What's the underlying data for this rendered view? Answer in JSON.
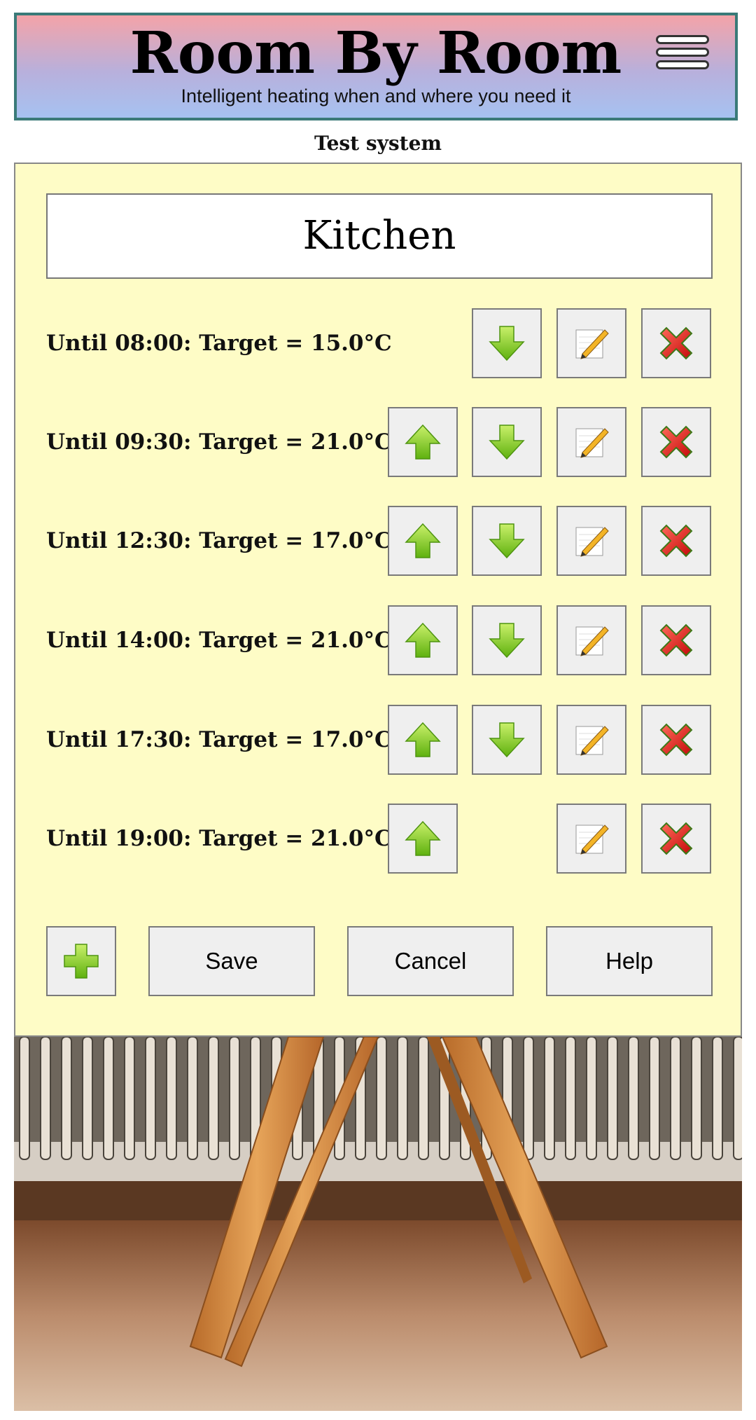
{
  "header": {
    "title": "Room By Room",
    "subtitle": "Intelligent heating when and where you need it",
    "menu_icon": "hamburger-menu-icon"
  },
  "system_name": "Test system",
  "room": {
    "name": "Kitchen",
    "schedule": [
      {
        "label": "Until 08:00: Target = 15.0°C",
        "can_move_up": false,
        "can_move_down": true
      },
      {
        "label": "Until 09:30: Target = 21.0°C",
        "can_move_up": true,
        "can_move_down": true
      },
      {
        "label": "Until 12:30: Target = 17.0°C",
        "can_move_up": true,
        "can_move_down": true
      },
      {
        "label": "Until 14:00: Target = 21.0°C",
        "can_move_up": true,
        "can_move_down": true
      },
      {
        "label": "Until 17:30: Target = 17.0°C",
        "can_move_up": true,
        "can_move_down": true
      },
      {
        "label": "Until 19:00: Target = 21.0°C",
        "can_move_up": true,
        "can_move_down": false
      }
    ]
  },
  "buttons": {
    "add_icon": "plus-icon",
    "save": "Save",
    "cancel": "Cancel",
    "help": "Help"
  },
  "icons": {
    "move_up": "green-up-arrow-icon",
    "move_down": "green-down-arrow-icon",
    "edit": "pencil-notepad-icon",
    "delete": "red-x-icon"
  },
  "colors": {
    "panel_bg": "#fefcc6",
    "header_top": "#f4a3a8",
    "header_bottom": "#a6c2f1",
    "header_border": "#3a7a78",
    "arrow_green": "#7ccc1c",
    "delete_red": "#e01818"
  },
  "background_image": "radiator-with-wooden-chair-legs-photo"
}
